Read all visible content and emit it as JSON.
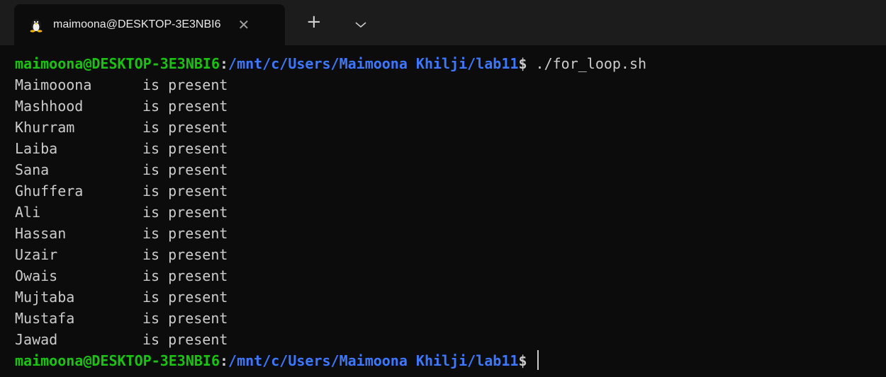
{
  "tab": {
    "title": "maimoona@DESKTOP-3E3NBI6",
    "close_glyph": "✕",
    "icon": "linux-penguin-icon"
  },
  "tabbar": {
    "new_tab_glyph": "+",
    "dropdown_icon": "chevron-down-icon"
  },
  "colors": {
    "prompt_user": "#16c60c",
    "prompt_path": "#3b78ff",
    "text": "#cccccc",
    "background": "#0c0c0c",
    "tabbar": "#1c1c1c"
  },
  "terminal": {
    "prompt1": {
      "user_host": "maimoona@DESKTOP-3E3NBI6",
      "colon": ":",
      "path": "/mnt/c/Users/Maimoona Khilji/lab11",
      "dollar": "$",
      "command": " ./for_loop.sh"
    },
    "output": [
      {
        "name": "Maimooona",
        "status": "is present"
      },
      {
        "name": "Mashhood",
        "status": "is present"
      },
      {
        "name": "Khurram",
        "status": "is present"
      },
      {
        "name": "Laiba",
        "status": "is present"
      },
      {
        "name": "Sana",
        "status": "is present"
      },
      {
        "name": "Ghuffera",
        "status": "is present"
      },
      {
        "name": "Ali",
        "status": "is present"
      },
      {
        "name": "Hassan",
        "status": "is present"
      },
      {
        "name": "Uzair",
        "status": "is present"
      },
      {
        "name": "Owais",
        "status": "is present"
      },
      {
        "name": "Mujtaba",
        "status": "is present"
      },
      {
        "name": "Mustafa",
        "status": "is present"
      },
      {
        "name": "Jawad",
        "status": "is present"
      }
    ],
    "prompt2": {
      "user_host": "maimoona@DESKTOP-3E3NBI6",
      "colon": ":",
      "path": "/mnt/c/Users/Maimoona Khilji/lab11",
      "dollar": "$",
      "command": " "
    }
  }
}
